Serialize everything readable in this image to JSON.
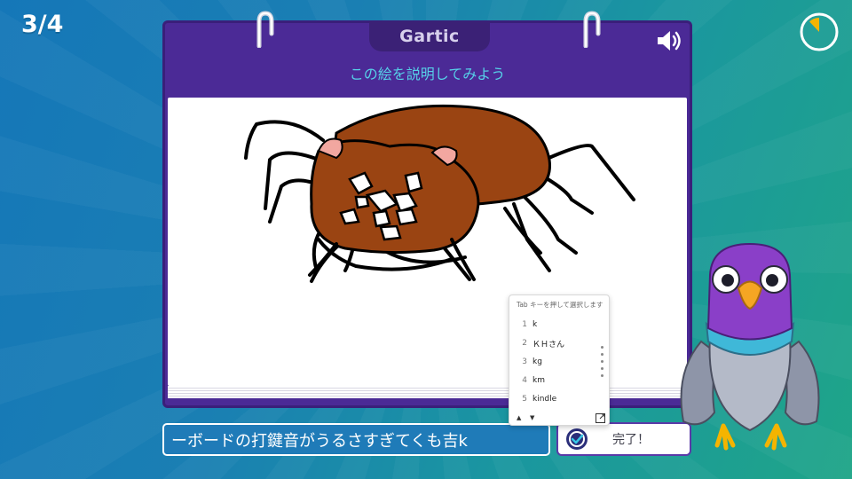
{
  "round": {
    "counter": "3/4"
  },
  "notebook": {
    "logo": "Gartic",
    "prompt": "この絵を説明してみよう",
    "sound_icon": "speaker-icon"
  },
  "timer": {
    "icon": "clock-icon",
    "remaining_fraction": 0.88,
    "color": "#f5b400"
  },
  "answer": {
    "value": "ーボードの打鍵音がうるさすぎてくも吉k"
  },
  "done_button": {
    "label": "完了！",
    "icon": "checkmark-icon"
  },
  "ime": {
    "hint": "Tab キーを押して選択します",
    "candidates": [
      {
        "num": "1",
        "text": "k"
      },
      {
        "num": "2",
        "text": "ＫＨさん"
      },
      {
        "num": "3",
        "text": "kg"
      },
      {
        "num": "4",
        "text": "km"
      },
      {
        "num": "5",
        "text": "kindle"
      }
    ],
    "nav_up": "▲",
    "nav_down": "▼",
    "expand_icon": "expand-icon"
  },
  "colors": {
    "notebook_purple": "#4b2a96",
    "prompt_cyan": "#56d0e8",
    "spider_brown": "#9a4412",
    "background_blue": "#1577b8",
    "background_green": "#1fa588"
  },
  "drawing": {
    "subject_icon": "spider-drawing"
  },
  "mascot": {
    "icon": "pigeon-mascot-icon"
  }
}
